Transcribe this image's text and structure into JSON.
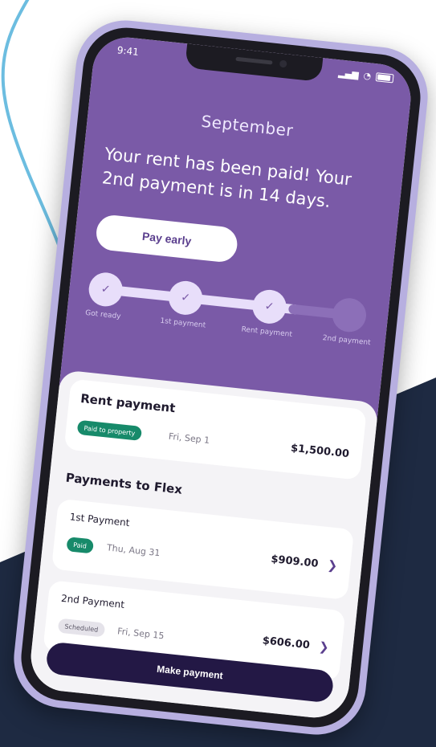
{
  "status": {
    "time": "9:41",
    "icons": [
      "signal-icon",
      "wifi-icon",
      "battery-icon"
    ]
  },
  "header": {
    "month": "September",
    "headline": "Your rent has been paid! Your 2nd payment is in 14 days.",
    "pay_early_label": "Pay early"
  },
  "progress": {
    "steps": [
      {
        "label": "Got ready",
        "done": true
      },
      {
        "label": "1st payment",
        "done": true
      },
      {
        "label": "Rent payment",
        "done": true
      },
      {
        "label": "2nd payment",
        "done": false
      }
    ]
  },
  "rent": {
    "title": "Rent payment",
    "badge": "Paid to property",
    "date": "Fri, Sep 1",
    "amount": "$1,500.00"
  },
  "flex": {
    "title": "Payments to Flex",
    "payments": [
      {
        "title": "1st Payment",
        "badge": "Paid",
        "date": "Thu, Aug 31",
        "amount": "$909.00"
      },
      {
        "title": "2nd Payment",
        "badge": "Scheduled",
        "date": "Fri, Sep 15",
        "amount": "$606.00"
      }
    ]
  },
  "make_payment_label": "Make payment",
  "colors": {
    "purple": "#7a5aa7",
    "navy": "#1e2a42",
    "green": "#178a6a",
    "arc": "#6cbde0"
  }
}
